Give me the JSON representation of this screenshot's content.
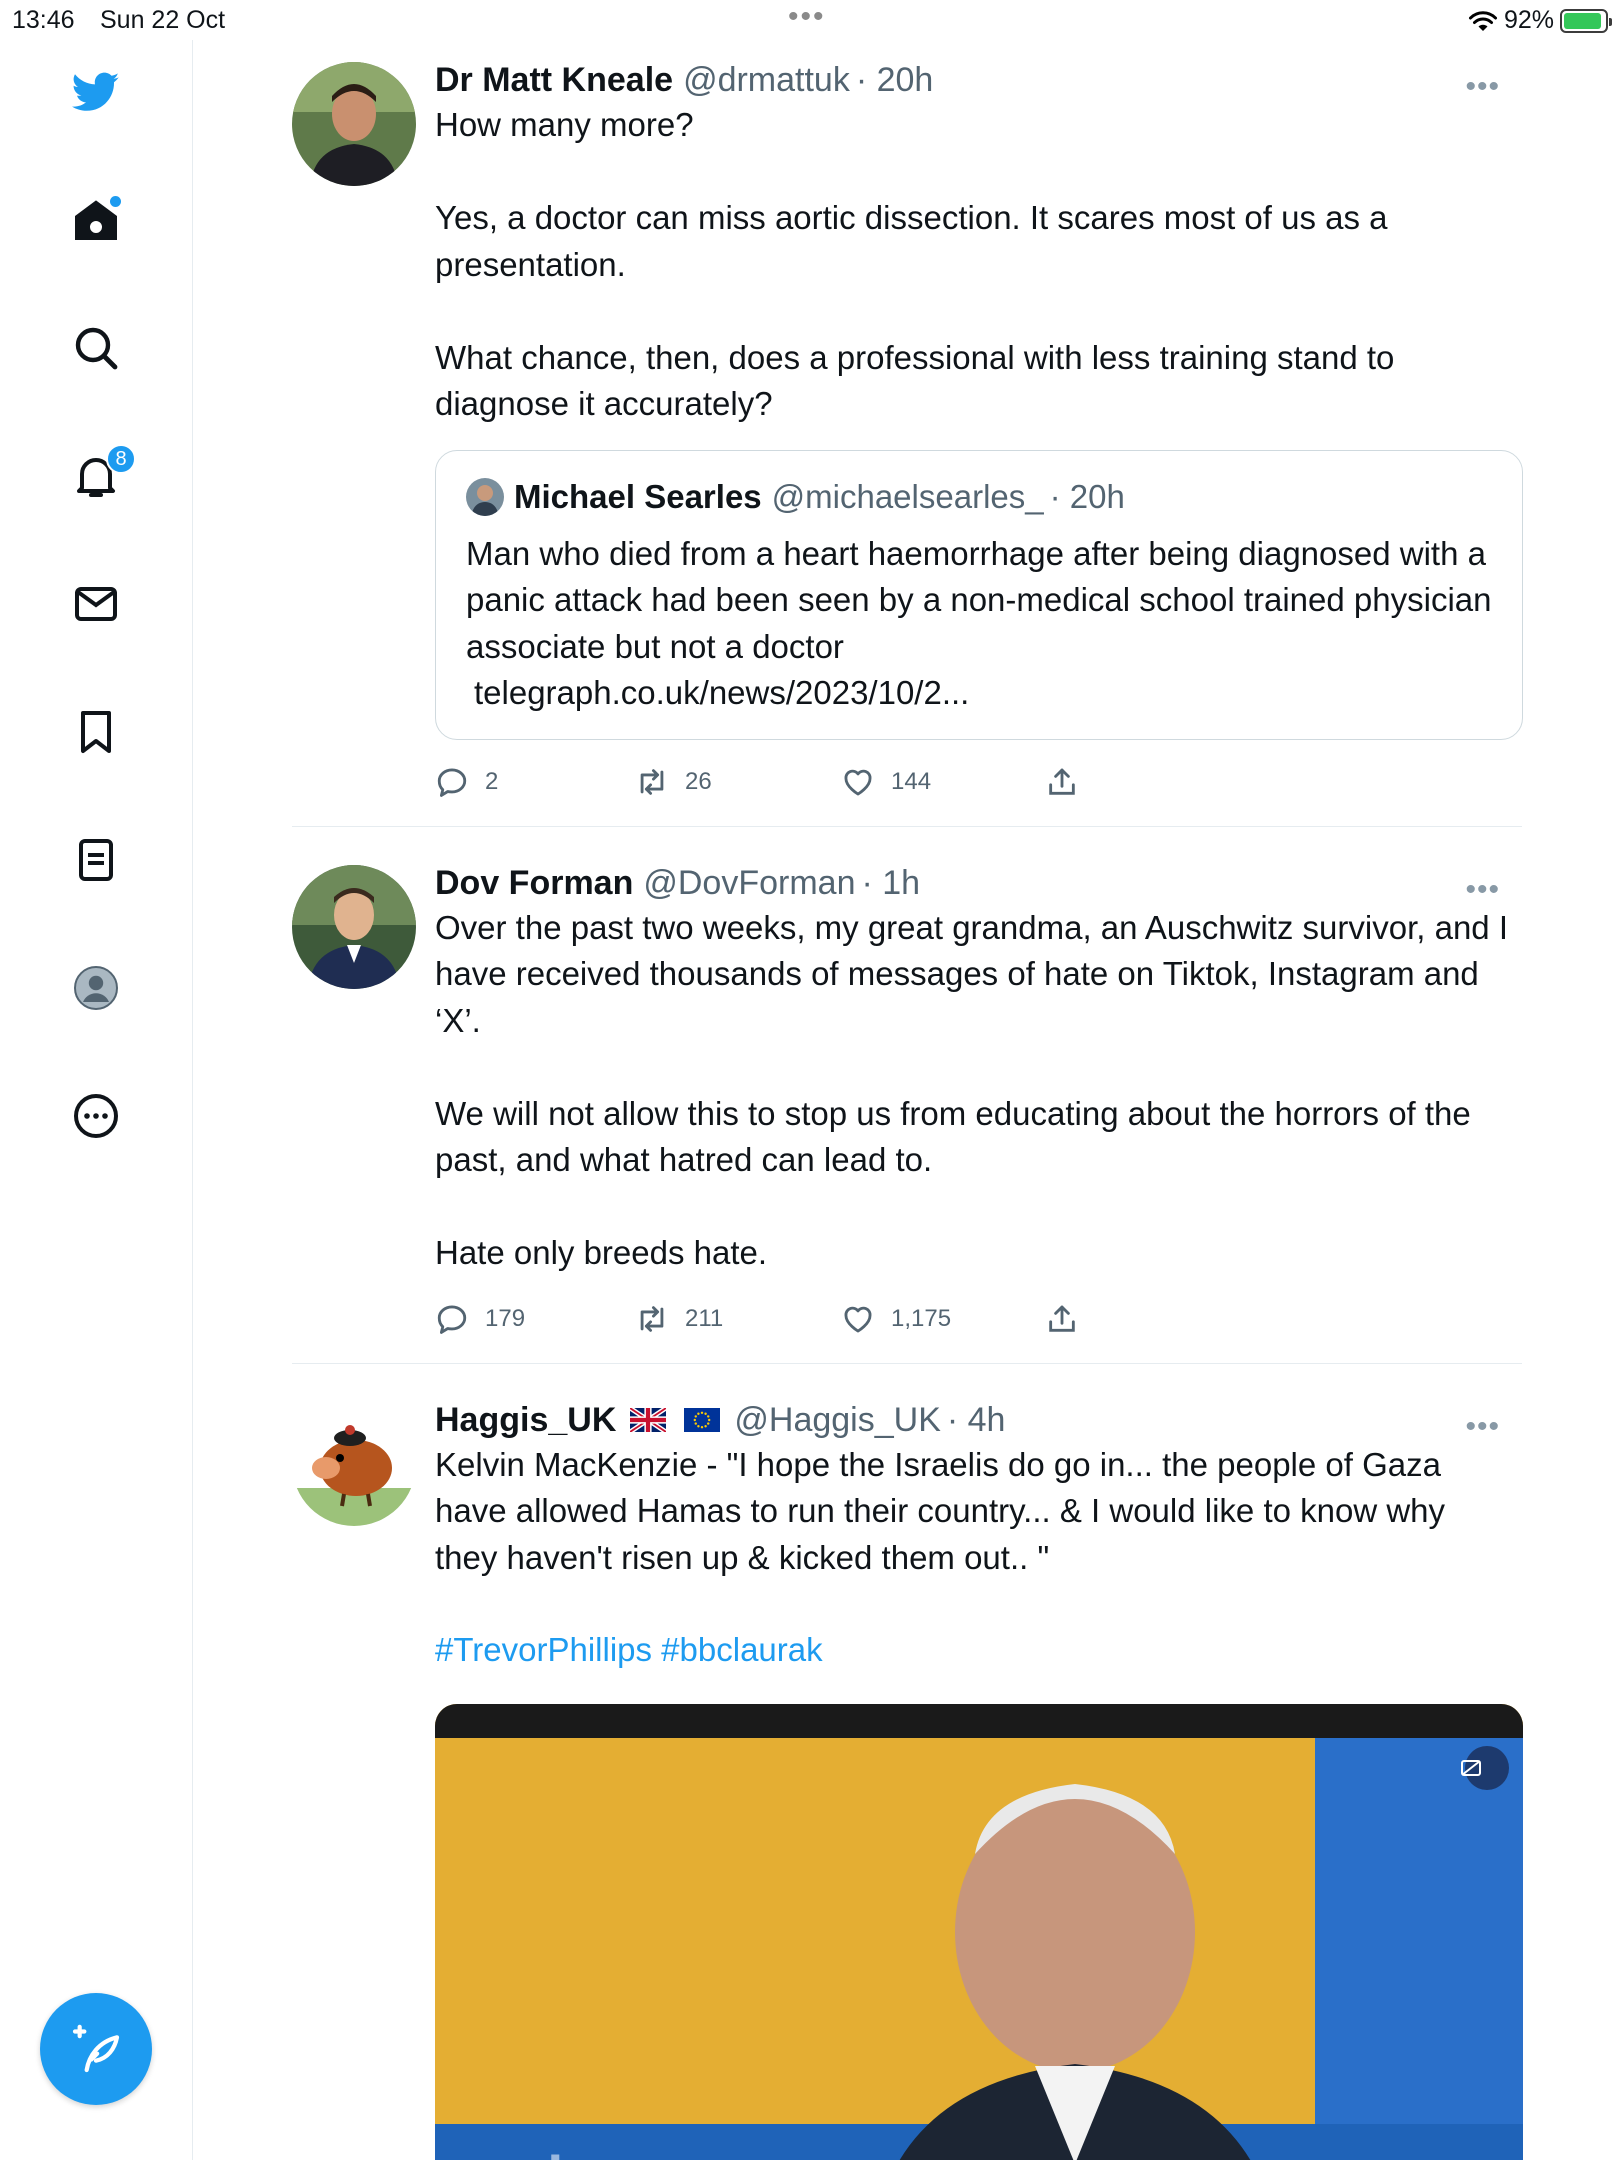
{
  "status_bar": {
    "time": "13:46",
    "date": "Sun 22 Oct",
    "dots": "•••",
    "battery": "92%",
    "battery_level": 0.92
  },
  "sidebar": {
    "items": [
      {
        "name": "twitter-logo",
        "icon": "bird-icon"
      },
      {
        "name": "home",
        "icon": "home-icon",
        "has_dot": true
      },
      {
        "name": "explore",
        "icon": "search-icon"
      },
      {
        "name": "notifications",
        "icon": "bell-icon",
        "badge": "8"
      },
      {
        "name": "messages",
        "icon": "mail-icon"
      },
      {
        "name": "bookmarks",
        "icon": "bookmark-icon"
      },
      {
        "name": "lists",
        "icon": "list-icon"
      },
      {
        "name": "profile",
        "icon": "profile-icon"
      },
      {
        "name": "more",
        "icon": "more-circle-icon"
      }
    ],
    "compose_icon": "compose-feather-icon"
  },
  "colors": {
    "accent": "#1d9bf0",
    "text": "#0f1419",
    "secondary": "#536471",
    "border": "#e6ecf0"
  },
  "tweets": [
    {
      "name": "Dr Matt Kneale",
      "handle": "@drmattuk",
      "time": "· 20h",
      "text": "How many more?\n\nYes, a doctor can miss aortic dissection. It scares most of us as a presentation.\n\nWhat chance, then, does a professional with less training stand to diagnose it accurately?",
      "quote": {
        "name": "Michael Searles",
        "handle": "@michaelsearles_",
        "time": "· 20h",
        "text": "Man who died from a heart haemorrhage after being diagnosed with a panic attack had been seen by a non-medical school trained physician associate but not a doctor",
        "link": "telegraph.co.uk/news/2023/10/2..."
      },
      "replies": "2",
      "retweets": "26",
      "likes": "144"
    },
    {
      "name": "Dov Forman",
      "handle": "@DovForman",
      "time": "· 1h",
      "text": "Over the past two weeks, my great grandma, an Auschwitz survivor, and I have received thousands of messages of hate on Tiktok, Instagram and ‘X’.\n\nWe will not allow this to stop us from educating about the horrors of the past, and what hatred can lead to.\n\nHate only breeds hate.",
      "replies": "179",
      "retweets": "211",
      "likes": "1,175"
    },
    {
      "name": "Haggis_UK",
      "handle": "@Haggis_UK",
      "time": "· 4h",
      "flags": [
        "uk-flag-icon",
        "eu-flag-icon"
      ],
      "text": "Kelvin MacKenzie - \"I hope the Israelis do go in... the people of Gaza have allowed Hamas to run their country... & I would like to know why they haven't risen up & kicked them out.. \"",
      "hashtags": "#TrevorPhillips #bbclaurak",
      "media": {
        "watermark": "sky news"
      }
    }
  ],
  "more_label": "•••"
}
